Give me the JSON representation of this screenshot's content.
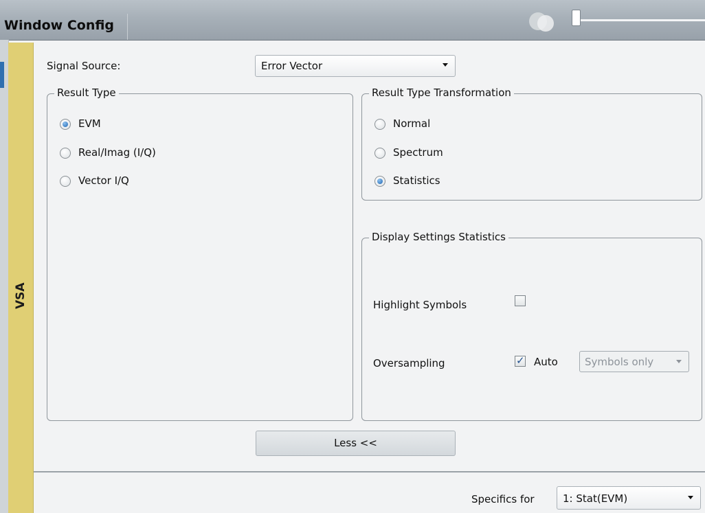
{
  "window": {
    "title": "Window Config"
  },
  "sidebar_tab": {
    "label": "VSA"
  },
  "signal_source": {
    "label": "Signal Source:",
    "value": "Error Vector"
  },
  "result_type": {
    "legend": "Result Type",
    "options": [
      {
        "label": "EVM",
        "selected": true
      },
      {
        "label": "Real/Imag (I/Q)",
        "selected": false
      },
      {
        "label": "Vector I/Q",
        "selected": false
      }
    ]
  },
  "transformation": {
    "legend": "Result Type Transformation",
    "options": [
      {
        "label": "Normal",
        "selected": false
      },
      {
        "label": "Spectrum",
        "selected": false
      },
      {
        "label": "Statistics",
        "selected": true
      }
    ]
  },
  "display_settings": {
    "legend": "Display Settings Statistics",
    "highlight_symbols_label": "Highlight Symbols",
    "highlight_symbols_checked": false,
    "oversampling_label": "Oversampling",
    "auto_label": "Auto",
    "auto_checked": true,
    "oversampling_value": "Symbols only"
  },
  "less_button": {
    "label": "Less <<"
  },
  "specifics": {
    "label": "Specifics for",
    "value": "1: Stat(EVM)"
  }
}
